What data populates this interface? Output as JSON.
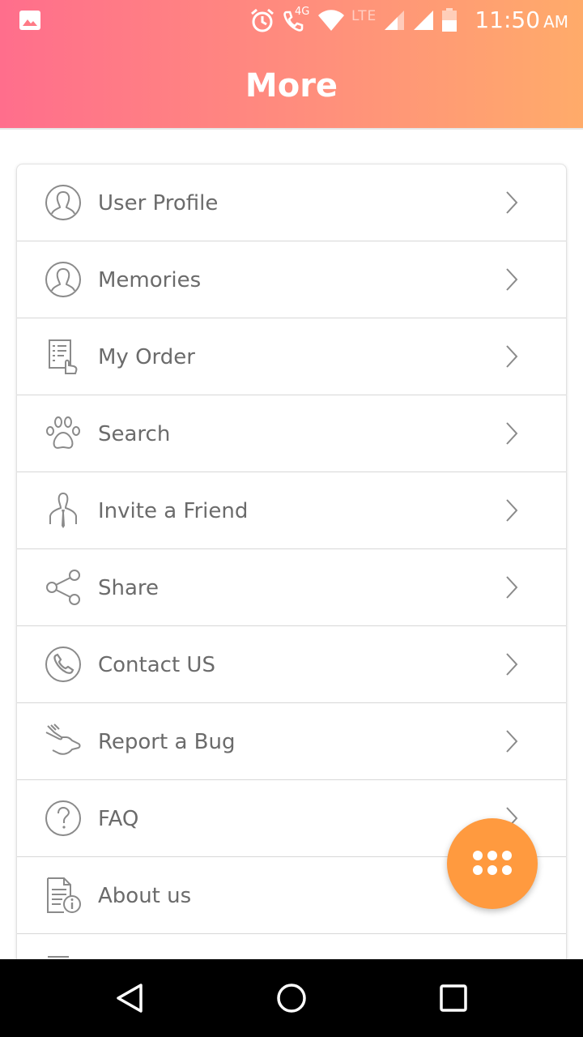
{
  "status_bar": {
    "time": "11:50",
    "ampm": "AM",
    "network_badge": "4G",
    "network_type": "LTE",
    "icons": [
      "gallery-icon",
      "alarm-icon",
      "wifi-call-icon",
      "wifi-icon",
      "signal-icon",
      "battery-icon"
    ]
  },
  "header": {
    "title": "More",
    "gradient_colors": [
      "#ff6e8c",
      "#ffab6a"
    ]
  },
  "menu": {
    "items": [
      {
        "label": "User Profile",
        "icon": "user-profile-icon"
      },
      {
        "label": "Memories",
        "icon": "memories-icon"
      },
      {
        "label": "My Order",
        "icon": "order-icon"
      },
      {
        "label": "Search",
        "icon": "paw-icon"
      },
      {
        "label": "Invite a Friend",
        "icon": "person-tie-icon"
      },
      {
        "label": "Share",
        "icon": "share-icon"
      },
      {
        "label": "Contact US",
        "icon": "phone-icon"
      },
      {
        "label": "Report a Bug",
        "icon": "pointing-hand-icon"
      },
      {
        "label": "FAQ",
        "icon": "question-icon"
      },
      {
        "label": "About us",
        "icon": "document-info-icon"
      }
    ]
  },
  "fab": {
    "icon": "grid-dots-icon",
    "color": "#ff9a3f"
  },
  "nav_bar": {
    "buttons": [
      "back-icon",
      "home-icon",
      "recents-icon"
    ]
  }
}
